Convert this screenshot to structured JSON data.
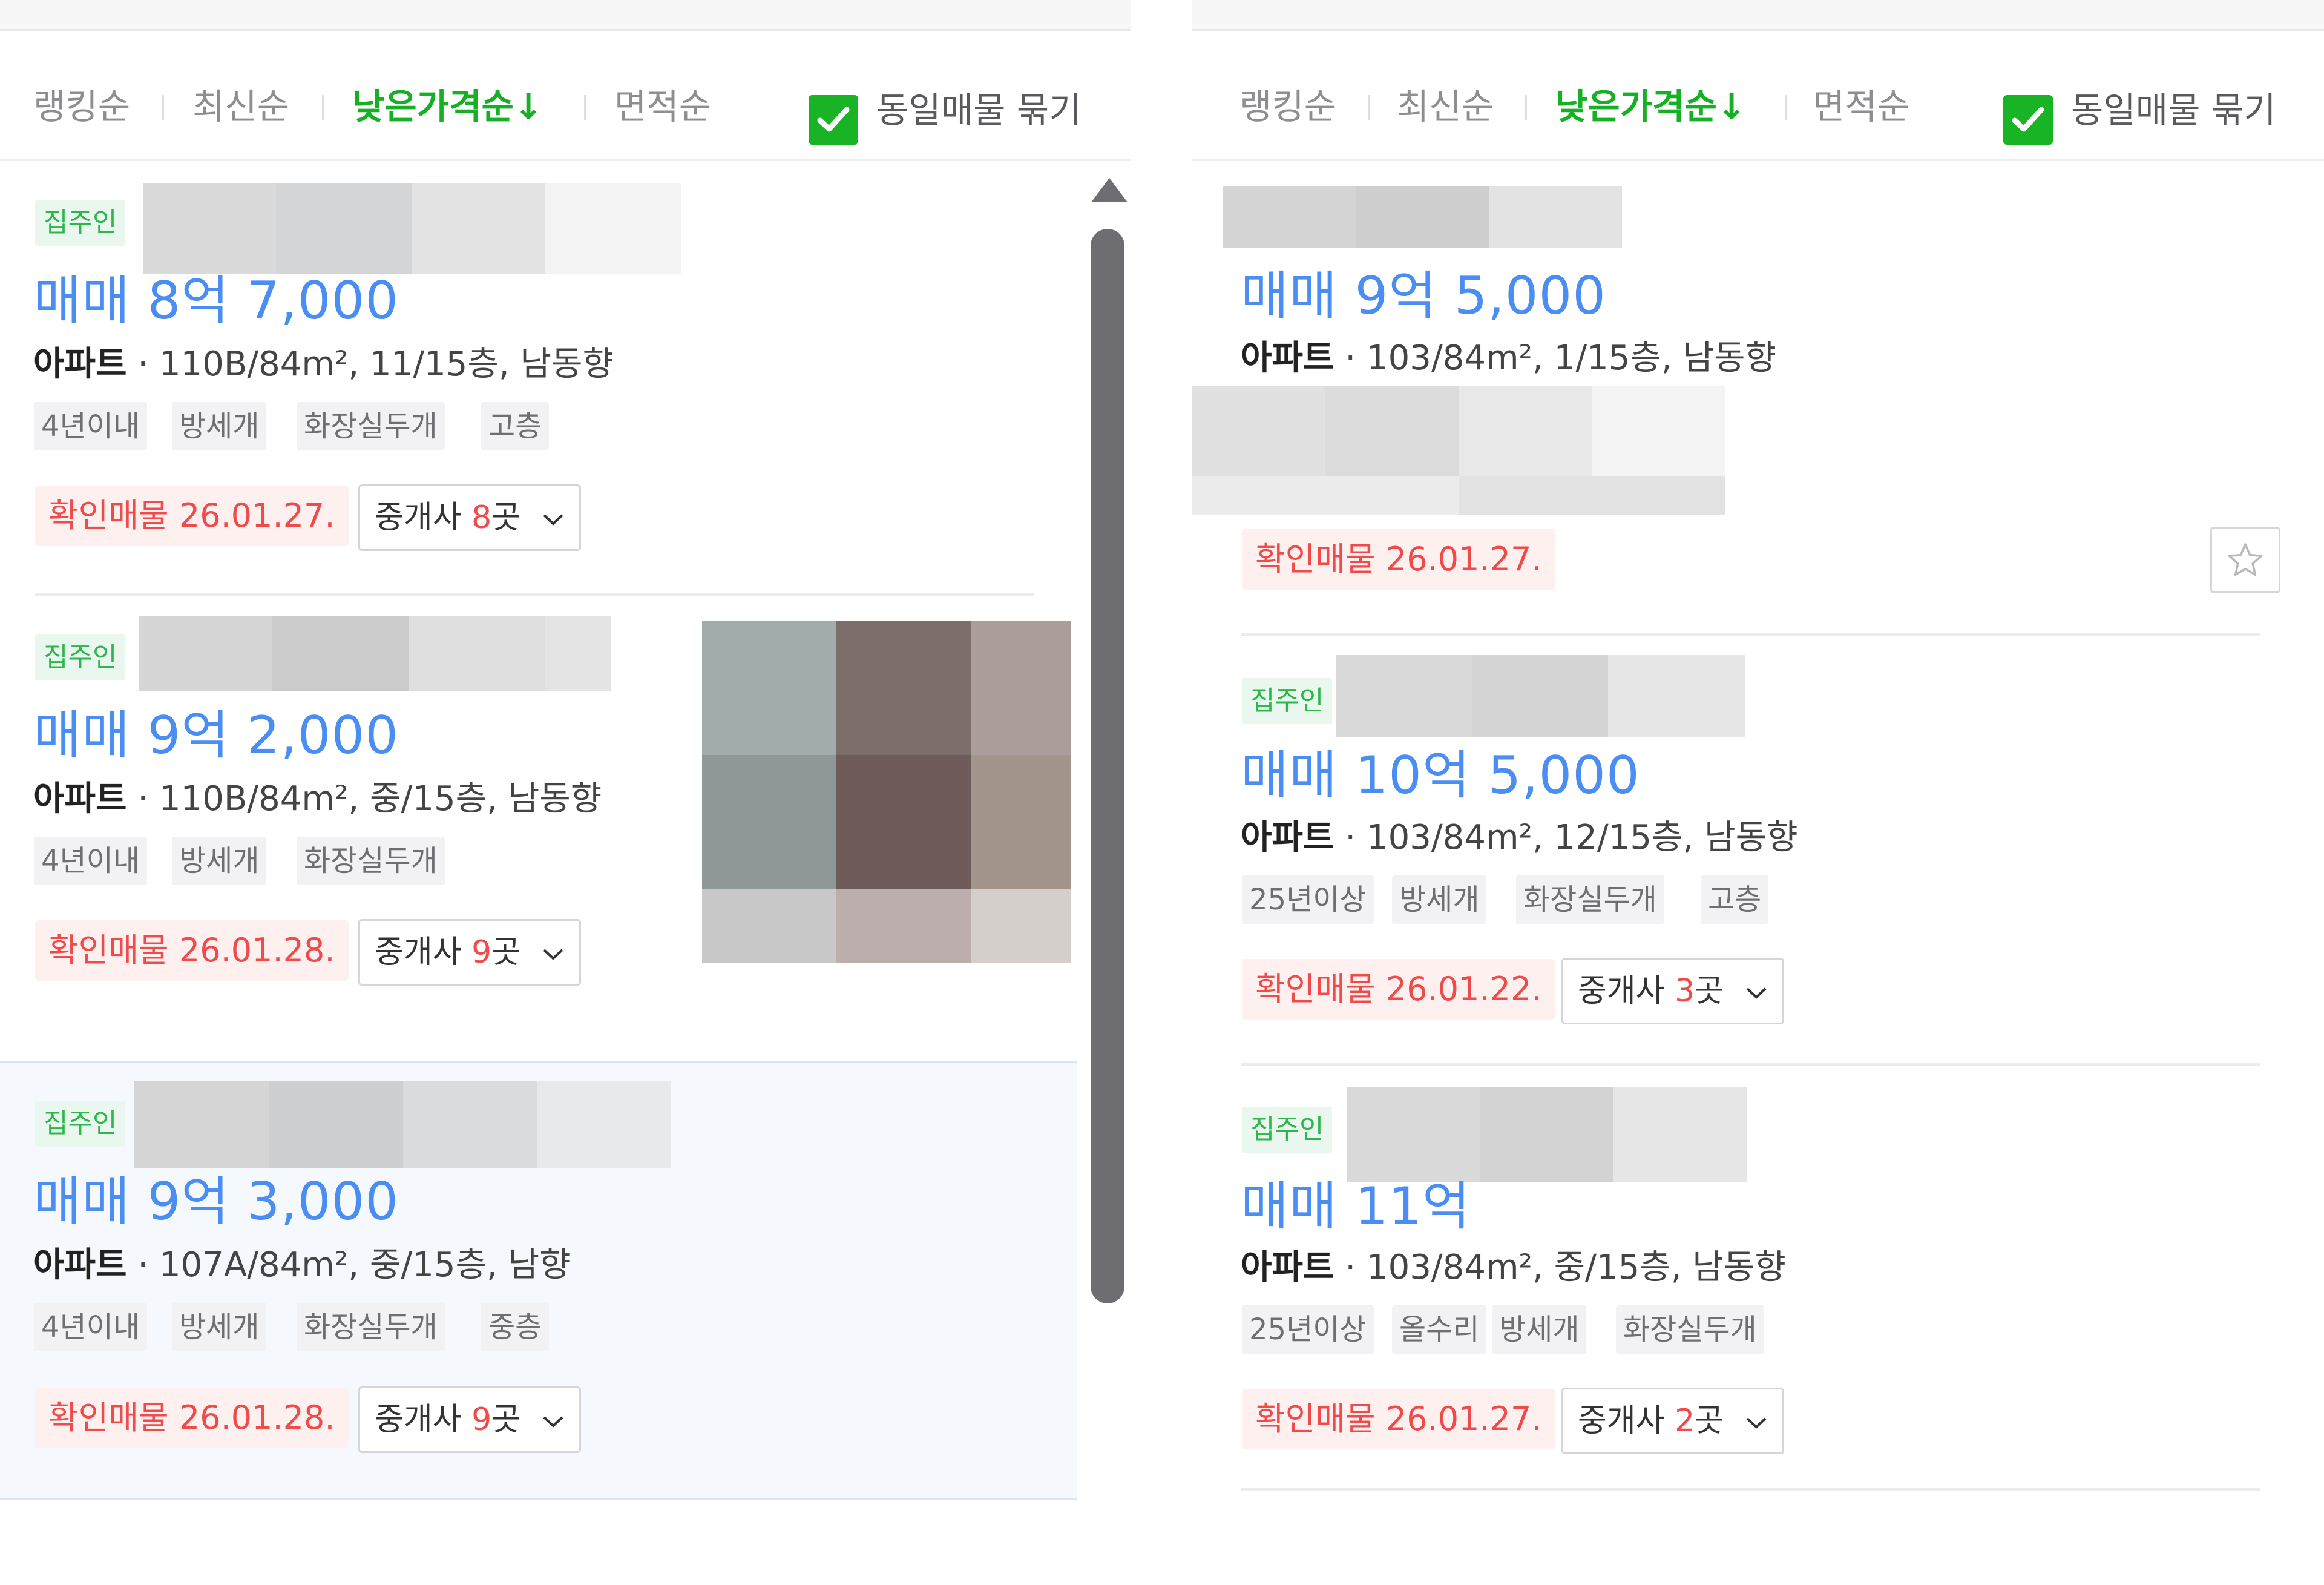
{
  "sort_bar": {
    "options": [
      "랭킹순",
      "최신순",
      "낮은가격순↓",
      "면적순"
    ],
    "active": "낮은가격순↓",
    "group_checkbox_label": "동일매물 묶기",
    "group_checked": true
  },
  "left_panel": {
    "listings": [
      {
        "owner_badge": "집주인",
        "price": "매매 8억 7,000",
        "type": "아파트",
        "detail": "110B/84m², 11/15층, 남동향",
        "tags": [
          "4년이내",
          "방세개",
          "화장실두개",
          "고층"
        ],
        "confirmed": "확인매물 26.01.27.",
        "agent_prefix": "중개사 ",
        "agent_count": "8",
        "agent_suffix": "곳"
      },
      {
        "owner_badge": "집주인",
        "price": "매매 9억 2,000",
        "type": "아파트",
        "detail": "110B/84m², 중/15층, 남동향",
        "tags": [
          "4년이내",
          "방세개",
          "화장실두개"
        ],
        "confirmed": "확인매물 26.01.28.",
        "agent_prefix": "중개사 ",
        "agent_count": "9",
        "agent_suffix": "곳"
      },
      {
        "owner_badge": "집주인",
        "price": "매매 9억 3,000",
        "type": "아파트",
        "detail": "107A/84m², 중/15층, 남향",
        "tags": [
          "4년이내",
          "방세개",
          "화장실두개",
          "중층"
        ],
        "confirmed": "확인매물 26.01.28.",
        "agent_prefix": "중개사 ",
        "agent_count": "9",
        "agent_suffix": "곳"
      }
    ]
  },
  "right_panel": {
    "listings": [
      {
        "price": "매매 9억 5,000",
        "type": "아파트",
        "detail": "103/84m², 1/15층, 남동향",
        "confirmed": "확인매물 26.01.27."
      },
      {
        "owner_badge": "집주인",
        "price": "매매 10억 5,000",
        "type": "아파트",
        "detail": "103/84m², 12/15층, 남동향",
        "tags": [
          "25년이상",
          "방세개",
          "화장실두개",
          "고층"
        ],
        "confirmed": "확인매물 26.01.22.",
        "agent_prefix": "중개사 ",
        "agent_count": "3",
        "agent_suffix": "곳"
      },
      {
        "owner_badge": "집주인",
        "price": "매매 11억",
        "type": "아파트",
        "detail": "103/84m², 중/15층, 남동향",
        "tags": [
          "25년이상",
          "올수리",
          "방세개",
          "화장실두개"
        ],
        "confirmed": "확인매물 26.01.27.",
        "agent_prefix": "중개사 ",
        "agent_count": "2",
        "agent_suffix": "곳"
      }
    ]
  },
  "icons": {
    "check": "check-icon",
    "chevron": "chevron-down-icon",
    "star": "star-outline-icon",
    "scroll_up": "scroll-up-arrow-icon"
  },
  "colors": {
    "price": "#4a8df3",
    "active_sort": "#15b024",
    "confirmed": "#f04a4a",
    "owner_badge": "#2db64a"
  }
}
